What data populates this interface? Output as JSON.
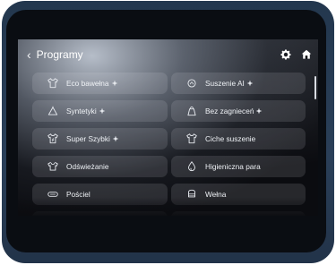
{
  "header": {
    "title": "Programy",
    "back_glyph": "‹"
  },
  "icons": {
    "settings": "gear-icon",
    "home": "home-icon",
    "ai_badge": "sparkle-icon"
  },
  "programs": [
    {
      "label": "Eco bawełna",
      "icon": "cotton-shirt-icon",
      "ai": true
    },
    {
      "label": "Suszenie AI",
      "icon": "ai-dry-icon",
      "ai": true
    },
    {
      "label": "Syntetyki",
      "icon": "synthetics-icon",
      "ai": true
    },
    {
      "label": "Bez zagnieceń",
      "icon": "no-wrinkle-icon",
      "ai": true
    },
    {
      "label": "Super Szybki",
      "icon": "fast-shirt-icon",
      "ai": true
    },
    {
      "label": "Ciche suszenie",
      "icon": "quiet-dry-icon",
      "ai": false
    },
    {
      "label": "Odświeżanie",
      "icon": "refresh-shirt-icon",
      "ai": false
    },
    {
      "label": "Higieniczna para",
      "icon": "steam-drop-icon",
      "ai": false
    },
    {
      "label": "Pościel",
      "icon": "bedding-icon",
      "ai": false
    },
    {
      "label": "Wełna",
      "icon": "wool-icon",
      "ai": false
    }
  ],
  "colors": {
    "bezel": "#27394f",
    "tile": "rgba(230,234,240,0.13)",
    "text": "#eef1f5"
  }
}
